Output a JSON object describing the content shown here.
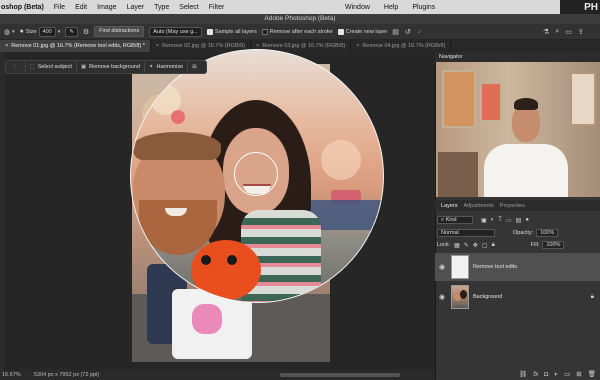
{
  "menubar": {
    "app": "oshop (Beta)",
    "items": [
      "File",
      "Edit",
      "Image",
      "Layer",
      "Type",
      "Select",
      "Filter"
    ],
    "right_items": [
      "Window",
      "Help",
      "Plugins"
    ],
    "corner_text": "PH"
  },
  "title": "Adobe Photoshop (Beta)",
  "options": {
    "size_label": "Size",
    "size_value": "400",
    "find_distractions": "Find distractions",
    "mode_value": "Auto (May use g...",
    "sample_all_layers": "Sample all layers",
    "remove_after_stroke": "Remove after each stroke",
    "create_new_layer": "Create new layer"
  },
  "tabs": [
    {
      "label": "Remove 01.jpg @ 16.7% (Remove tool edits, RGB/8) *",
      "active": true
    },
    {
      "label": "Remove 02.jpg @ 16.7% (RGB/8)",
      "active": false
    },
    {
      "label": "Remove 03.jpg @ 16.7% (RGB/8)",
      "active": false
    },
    {
      "label": "Remove 04.jpg @ 16.7% (RGB/8)",
      "active": false
    }
  ],
  "context_bar": {
    "select_subject": "Select subject",
    "remove_background": "Remove background",
    "harmonize": "Harmonize"
  },
  "status": {
    "zoom": "16.67%",
    "dimensions": "5304 px x 7952 px (72 ppi)"
  },
  "navigator": {
    "title": "Navigator"
  },
  "layers_panel": {
    "tabs": [
      "Layers",
      "Adjustments",
      "Properties"
    ],
    "filter_label": "Kind",
    "blend_mode": "Normal",
    "opacity_label": "Opacity:",
    "opacity_value": "100%",
    "lock_label": "Lock:",
    "fill_label": "Fill:",
    "fill_value": "100%",
    "layers": [
      {
        "name": "Remove tool edits",
        "active": true
      },
      {
        "name": "Background",
        "active": false
      }
    ]
  },
  "colors": {
    "accent": "#d9d9d9",
    "panel": "#353535",
    "canvas": "#262626"
  }
}
